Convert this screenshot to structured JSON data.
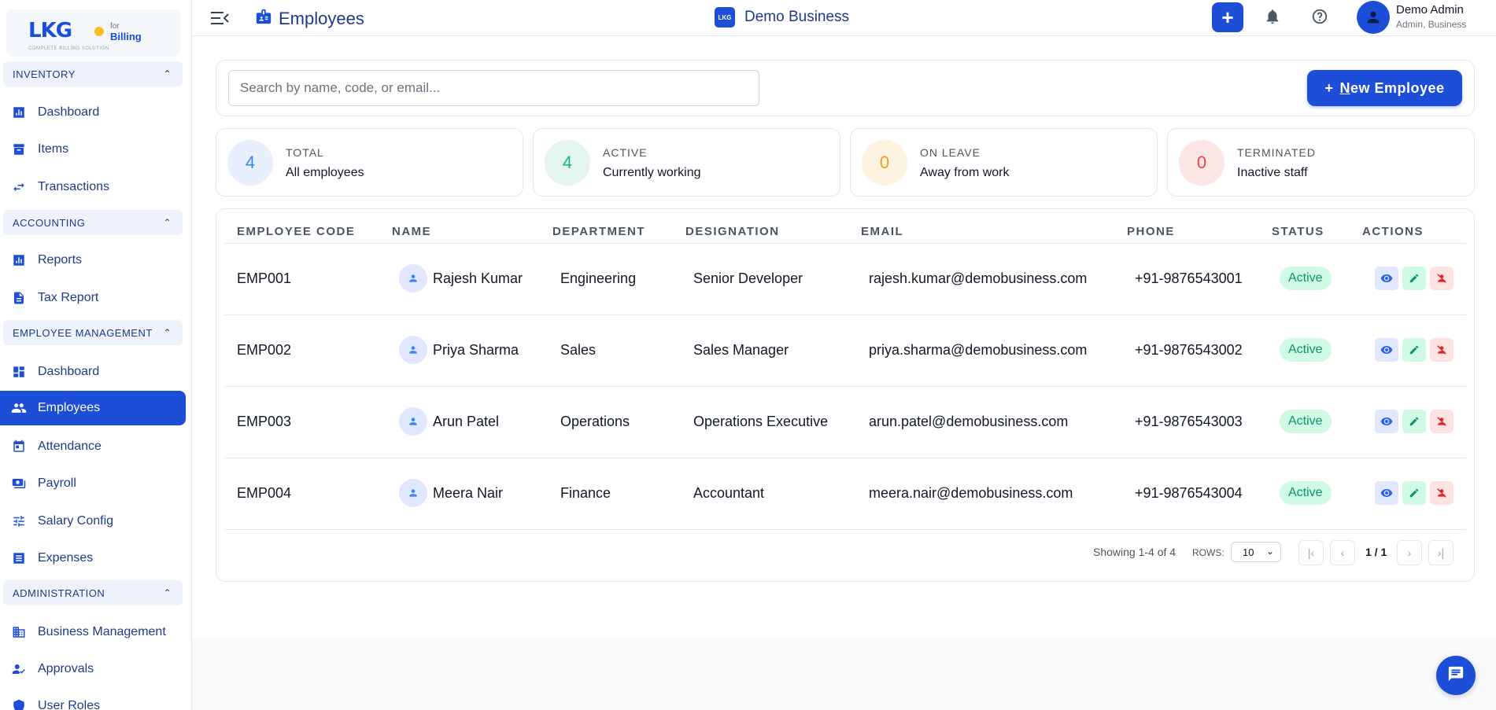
{
  "brand": {
    "logo_text": "LKG",
    "for_text": "for",
    "product": "Billing",
    "tagline": "COMPLETE BILLING SOLUTION",
    "accent_color": "#1d4ed8"
  },
  "sidebar": {
    "sections": [
      {
        "label": "INVENTORY",
        "items": [
          {
            "label": "Dashboard",
            "icon": "bar-chart-icon"
          },
          {
            "label": "Items",
            "icon": "archive-box-icon"
          },
          {
            "label": "Transactions",
            "icon": "swap-arrows-icon"
          }
        ]
      },
      {
        "label": "ACCOUNTING",
        "items": [
          {
            "label": "Reports",
            "icon": "bar-chart-icon"
          },
          {
            "label": "Tax Report",
            "icon": "document-icon"
          }
        ]
      },
      {
        "label": "EMPLOYEE MANAGEMENT",
        "items": [
          {
            "label": "Dashboard",
            "icon": "dashboard-grid-icon"
          },
          {
            "label": "Employees",
            "icon": "people-icon",
            "active": true
          },
          {
            "label": "Attendance",
            "icon": "calendar-icon"
          },
          {
            "label": "Payroll",
            "icon": "payments-icon"
          },
          {
            "label": "Salary Config",
            "icon": "sliders-icon"
          },
          {
            "label": "Expenses",
            "icon": "receipt-icon"
          }
        ]
      },
      {
        "label": "ADMINISTRATION",
        "items": [
          {
            "label": "Business Management",
            "icon": "building-icon"
          },
          {
            "label": "Approvals",
            "icon": "person-check-icon"
          },
          {
            "label": "User Roles",
            "icon": "shield-icon"
          }
        ]
      }
    ]
  },
  "topbar": {
    "page_title": "Employees",
    "business_logo_text": "LKG",
    "business_name": "Demo Business",
    "user_name": "Demo Admin",
    "user_role": "Admin, Business"
  },
  "search": {
    "placeholder": "Search by name, code, or email...",
    "value": ""
  },
  "new_employee_button": {
    "plus": "+",
    "label_prefix": "N",
    "label_rest": "ew Employee"
  },
  "stats": [
    {
      "value": "4",
      "label": "TOTAL",
      "sub": "All employees",
      "color": "#3b82f6",
      "bg": "#e8effc"
    },
    {
      "value": "4",
      "label": "ACTIVE",
      "sub": "Currently working",
      "color": "#10b981",
      "bg": "#e3f5ee"
    },
    {
      "value": "0",
      "label": "ON LEAVE",
      "sub": "Away from work",
      "color": "#f59e0b",
      "bg": "#fdf3e1"
    },
    {
      "value": "0",
      "label": "TERMINATED",
      "sub": "Inactive staff",
      "color": "#ef4444",
      "bg": "#fce5e5"
    }
  ],
  "table": {
    "columns": [
      "EMPLOYEE CODE",
      "NAME",
      "DEPARTMENT",
      "DESIGNATION",
      "EMAIL",
      "PHONE",
      "STATUS",
      "ACTIONS"
    ],
    "rows": [
      {
        "code": "EMP001",
        "name": "Rajesh Kumar",
        "department": "Engineering",
        "designation": "Senior Developer",
        "email": "rajesh.kumar@demobusiness.com",
        "phone": "+91-9876543001",
        "status": "Active"
      },
      {
        "code": "EMP002",
        "name": "Priya Sharma",
        "department": "Sales",
        "designation": "Sales Manager",
        "email": "priya.sharma@demobusiness.com",
        "phone": "+91-9876543002",
        "status": "Active"
      },
      {
        "code": "EMP003",
        "name": "Arun Patel",
        "department": "Operations",
        "designation": "Operations Executive",
        "email": "arun.patel@demobusiness.com",
        "phone": "+91-9876543003",
        "status": "Active"
      },
      {
        "code": "EMP004",
        "name": "Meera Nair",
        "department": "Finance",
        "designation": "Accountant",
        "email": "meera.nair@demobusiness.com",
        "phone": "+91-9876543004",
        "status": "Active"
      }
    ]
  },
  "pagination": {
    "showing": "Showing 1-4 of 4",
    "rows_label": "ROWS:",
    "rows_value": "10",
    "page": "1 / 1"
  }
}
